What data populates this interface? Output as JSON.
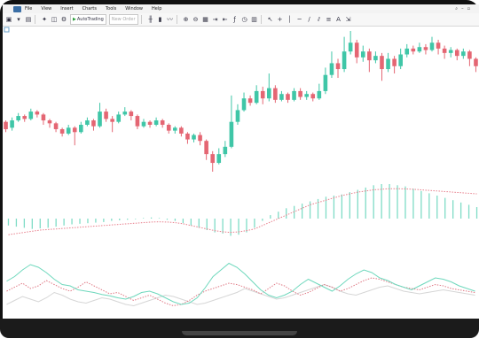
{
  "menu": {
    "items": [
      "File",
      "View",
      "Insert",
      "Charts",
      "Tools",
      "Window",
      "Help"
    ]
  },
  "toolbar": {
    "autotrading_label": "AutoTrading",
    "new_order_label": "New Order",
    "icons": [
      "new-chart-icon",
      "profiles-icon",
      "market-watch-icon",
      "navigator-icon",
      "terminal-icon",
      "strategy-tester-icon",
      "bar-chart-icon",
      "candlestick-icon",
      "line-chart-icon",
      "zoom-in-icon",
      "zoom-out-icon",
      "tile-icon",
      "autoscroll-icon",
      "chart-shift-icon",
      "indicators-icon",
      "periods-icon",
      "templates-icon",
      "cursor-icon",
      "crosshair-icon",
      "vertical-line-icon",
      "horizontal-line-icon",
      "trendline-icon",
      "equidistant-channel-icon",
      "fibonacci-icon",
      "text-icon",
      "arrows-icon"
    ]
  },
  "colors": {
    "bull": "#3fc6a7",
    "bear": "#e46673",
    "histogram": "#7fdcc6",
    "signal": "#e8808d",
    "osc_main": "#6fd8bd",
    "osc_signal": "#e07a86",
    "osc_third": "#d6d6d6",
    "background": "#ffffff"
  },
  "chart_data": {
    "type": "candlestick",
    "note_x": "bar index",
    "candles": [
      [
        1,
        1.12,
        1.07,
        1.13,
        1.05
      ],
      [
        2,
        1.08,
        1.13,
        1.15,
        1.06
      ],
      [
        3,
        1.13,
        1.16,
        1.18,
        1.12
      ],
      [
        4,
        1.16,
        1.14,
        1.17,
        1.12
      ],
      [
        5,
        1.14,
        1.19,
        1.21,
        1.13
      ],
      [
        6,
        1.19,
        1.17,
        1.2,
        1.15
      ],
      [
        7,
        1.17,
        1.13,
        1.18,
        1.1
      ],
      [
        8,
        1.13,
        1.11,
        1.14,
        1.08
      ],
      [
        9,
        1.11,
        1.07,
        1.12,
        1.05
      ],
      [
        10,
        1.07,
        1.04,
        1.08,
        1.02
      ],
      [
        11,
        1.04,
        1.08,
        1.1,
        1.03
      ],
      [
        12,
        1.08,
        1.05,
        1.09,
        0.96
      ],
      [
        13,
        1.05,
        1.1,
        1.12,
        1.04
      ],
      [
        14,
        1.1,
        1.13,
        1.15,
        1.09
      ],
      [
        15,
        1.13,
        1.09,
        1.14,
        1.06
      ],
      [
        16,
        1.09,
        1.19,
        1.25,
        1.08
      ],
      [
        17,
        1.19,
        1.14,
        1.21,
        1.12
      ],
      [
        18,
        1.14,
        1.12,
        1.16,
        1.05
      ],
      [
        19,
        1.12,
        1.17,
        1.19,
        1.11
      ],
      [
        20,
        1.17,
        1.19,
        1.22,
        1.16
      ],
      [
        21,
        1.19,
        1.16,
        1.2,
        1.13
      ],
      [
        22,
        1.16,
        1.09,
        1.17,
        1.07
      ],
      [
        23,
        1.09,
        1.12,
        1.14,
        1.08
      ],
      [
        24,
        1.12,
        1.1,
        1.13,
        1.08
      ],
      [
        25,
        1.1,
        1.13,
        1.15,
        1.09
      ],
      [
        26,
        1.13,
        1.1,
        1.14,
        1.08
      ],
      [
        27,
        1.1,
        1.06,
        1.11,
        1.04
      ],
      [
        28,
        1.06,
        1.08,
        1.09,
        1.04
      ],
      [
        29,
        1.08,
        1.04,
        1.09,
        1.02
      ],
      [
        30,
        1.04,
        1.0,
        1.05,
        0.97
      ],
      [
        31,
        1.0,
        1.03,
        1.04,
        0.98
      ],
      [
        32,
        1.03,
        0.99,
        1.05,
        0.96
      ],
      [
        33,
        0.99,
        0.9,
        1.0,
        0.86
      ],
      [
        34,
        0.9,
        0.84,
        0.92,
        0.78
      ],
      [
        35,
        0.84,
        0.9,
        0.94,
        0.83
      ],
      [
        36,
        0.9,
        0.95,
        0.99,
        0.88
      ],
      [
        37,
        0.95,
        1.12,
        1.3,
        0.94
      ],
      [
        38,
        1.12,
        1.2,
        1.24,
        1.1
      ],
      [
        39,
        1.2,
        1.28,
        1.32,
        1.19
      ],
      [
        40,
        1.28,
        1.25,
        1.3,
        1.23
      ],
      [
        41,
        1.25,
        1.33,
        1.37,
        1.24
      ],
      [
        42,
        1.33,
        1.28,
        1.36,
        1.24
      ],
      [
        43,
        1.28,
        1.35,
        1.45,
        1.26
      ],
      [
        44,
        1.35,
        1.27,
        1.37,
        1.25
      ],
      [
        45,
        1.27,
        1.31,
        1.33,
        1.26
      ],
      [
        46,
        1.31,
        1.27,
        1.32,
        1.25
      ],
      [
        47,
        1.27,
        1.33,
        1.35,
        1.26
      ],
      [
        48,
        1.33,
        1.29,
        1.35,
        1.27
      ],
      [
        49,
        1.29,
        1.31,
        1.33,
        1.27
      ],
      [
        50,
        1.31,
        1.28,
        1.32,
        1.26
      ],
      [
        51,
        1.28,
        1.33,
        1.38,
        1.27
      ],
      [
        52,
        1.33,
        1.44,
        1.49,
        1.31
      ],
      [
        53,
        1.44,
        1.52,
        1.6,
        1.42
      ],
      [
        54,
        1.52,
        1.48,
        1.55,
        1.42
      ],
      [
        55,
        1.48,
        1.6,
        1.7,
        1.46
      ],
      [
        56,
        1.6,
        1.66,
        1.74,
        1.58
      ],
      [
        57,
        1.66,
        1.56,
        1.68,
        1.52
      ],
      [
        58,
        1.56,
        1.6,
        1.64,
        1.53
      ],
      [
        59,
        1.6,
        1.54,
        1.62,
        1.46
      ],
      [
        60,
        1.54,
        1.57,
        1.6,
        1.52
      ],
      [
        61,
        1.57,
        1.48,
        1.59,
        1.4
      ],
      [
        62,
        1.48,
        1.55,
        1.59,
        1.46
      ],
      [
        63,
        1.55,
        1.5,
        1.57,
        1.45
      ],
      [
        64,
        1.5,
        1.58,
        1.62,
        1.48
      ],
      [
        65,
        1.58,
        1.62,
        1.65,
        1.56
      ],
      [
        66,
        1.62,
        1.6,
        1.64,
        1.58
      ],
      [
        67,
        1.6,
        1.63,
        1.66,
        1.59
      ],
      [
        68,
        1.63,
        1.61,
        1.65,
        1.58
      ],
      [
        69,
        1.61,
        1.66,
        1.7,
        1.6
      ],
      [
        70,
        1.66,
        1.62,
        1.68,
        1.58
      ],
      [
        71,
        1.62,
        1.59,
        1.64,
        1.55
      ],
      [
        72,
        1.59,
        1.61,
        1.63,
        1.56
      ],
      [
        73,
        1.61,
        1.57,
        1.62,
        1.54
      ],
      [
        74,
        1.57,
        1.6,
        1.62,
        1.55
      ],
      [
        75,
        1.6,
        1.55,
        1.61,
        1.5
      ],
      [
        76,
        1.55,
        1.5,
        1.56,
        1.46
      ]
    ],
    "histogram": [
      -0.6,
      -0.7,
      -0.8,
      -0.9,
      -0.85,
      -0.8,
      -0.7,
      -0.6,
      -0.5,
      -0.45,
      -0.4,
      -0.35,
      -0.3,
      -0.2,
      -0.15,
      -0.1,
      -0.05,
      0.05,
      0.1,
      0.05,
      -0.1,
      -0.2,
      -0.4,
      -0.6,
      -0.8,
      -1.0,
      -1.2,
      -1.3,
      -1.5,
      -1.4,
      -1.2,
      -0.8,
      -0.2,
      0.3,
      0.6,
      0.9,
      1.1,
      1.3,
      1.5,
      1.7,
      1.9,
      2.0,
      2.1,
      2.3,
      2.5,
      2.7,
      2.9,
      3.0,
      3.0,
      2.9,
      2.8,
      2.6,
      2.4,
      2.2,
      2.0,
      1.8,
      1.6,
      1.4,
      1.2,
      1.0
    ],
    "signal_line": [
      -1.4,
      -1.3,
      -1.2,
      -1.1,
      -1.0,
      -0.95,
      -0.9,
      -0.85,
      -0.8,
      -0.75,
      -0.7,
      -0.65,
      -0.6,
      -0.55,
      -0.5,
      -0.45,
      -0.4,
      -0.35,
      -0.3,
      -0.28,
      -0.3,
      -0.35,
      -0.45,
      -0.6,
      -0.75,
      -0.9,
      -1.05,
      -1.15,
      -1.2,
      -1.15,
      -1.05,
      -0.9,
      -0.6,
      -0.3,
      0.0,
      0.3,
      0.6,
      0.9,
      1.2,
      1.4,
      1.6,
      1.8,
      2.0,
      2.15,
      2.3,
      2.4,
      2.5,
      2.55,
      2.6,
      2.6,
      2.58,
      2.55,
      2.5,
      2.45,
      2.4,
      2.35,
      2.3,
      2.25,
      2.2,
      2.15
    ],
    "osc_main": [
      55,
      62,
      72,
      80,
      76,
      68,
      58,
      50,
      48,
      42,
      40,
      38,
      35,
      33,
      30,
      28,
      32,
      38,
      40,
      36,
      30,
      24,
      20,
      22,
      30,
      45,
      62,
      72,
      82,
      76,
      66,
      54,
      42,
      34,
      30,
      34,
      40,
      50,
      58,
      52,
      46,
      40,
      48,
      58,
      66,
      72,
      68,
      60,
      56,
      50,
      46,
      42,
      48,
      54,
      60,
      58,
      54,
      48,
      44,
      40
    ],
    "osc_signal": [
      40,
      46,
      52,
      44,
      48,
      56,
      50,
      44,
      40,
      46,
      54,
      48,
      42,
      36,
      38,
      32,
      26,
      30,
      34,
      28,
      22,
      18,
      20,
      26,
      34,
      40,
      44,
      48,
      52,
      50,
      46,
      42,
      36,
      44,
      52,
      48,
      40,
      34,
      38,
      44,
      50,
      46,
      40,
      44,
      50,
      56,
      60,
      58,
      54,
      50,
      46,
      44,
      42,
      46,
      50,
      48,
      44,
      42,
      40,
      38
    ],
    "osc_third": [
      20,
      26,
      32,
      28,
      24,
      30,
      38,
      34,
      28,
      24,
      22,
      26,
      30,
      28,
      24,
      20,
      18,
      22,
      26,
      30,
      34,
      32,
      28,
      24,
      20,
      22,
      26,
      30,
      34,
      38,
      44,
      40,
      36,
      32,
      28,
      30,
      34,
      38,
      42,
      46,
      50,
      46,
      40,
      36,
      34,
      38,
      42,
      46,
      48,
      44,
      40,
      38,
      36,
      38,
      40,
      42,
      40,
      38,
      36,
      34
    ]
  }
}
